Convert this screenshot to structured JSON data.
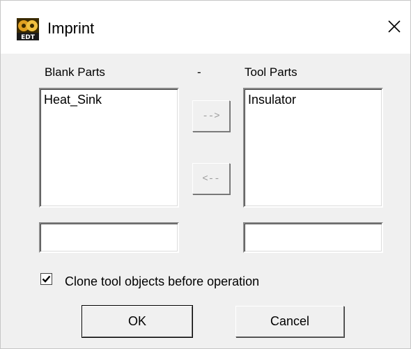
{
  "window": {
    "title": "Imprint",
    "icon": "edt-app-icon",
    "icon_text": "EDT",
    "close_icon": "close-icon"
  },
  "blank": {
    "label": "Blank Parts",
    "items": [
      "Heat_Sink"
    ],
    "input_value": ""
  },
  "separator": "-",
  "tool": {
    "label": "Tool Parts",
    "items": [
      "Insulator"
    ],
    "input_value": ""
  },
  "transfer": {
    "right_label": "-->",
    "left_label": "<--"
  },
  "clone": {
    "label": "Clone tool objects before operation",
    "checked": true
  },
  "buttons": {
    "ok": "OK",
    "cancel": "Cancel"
  }
}
